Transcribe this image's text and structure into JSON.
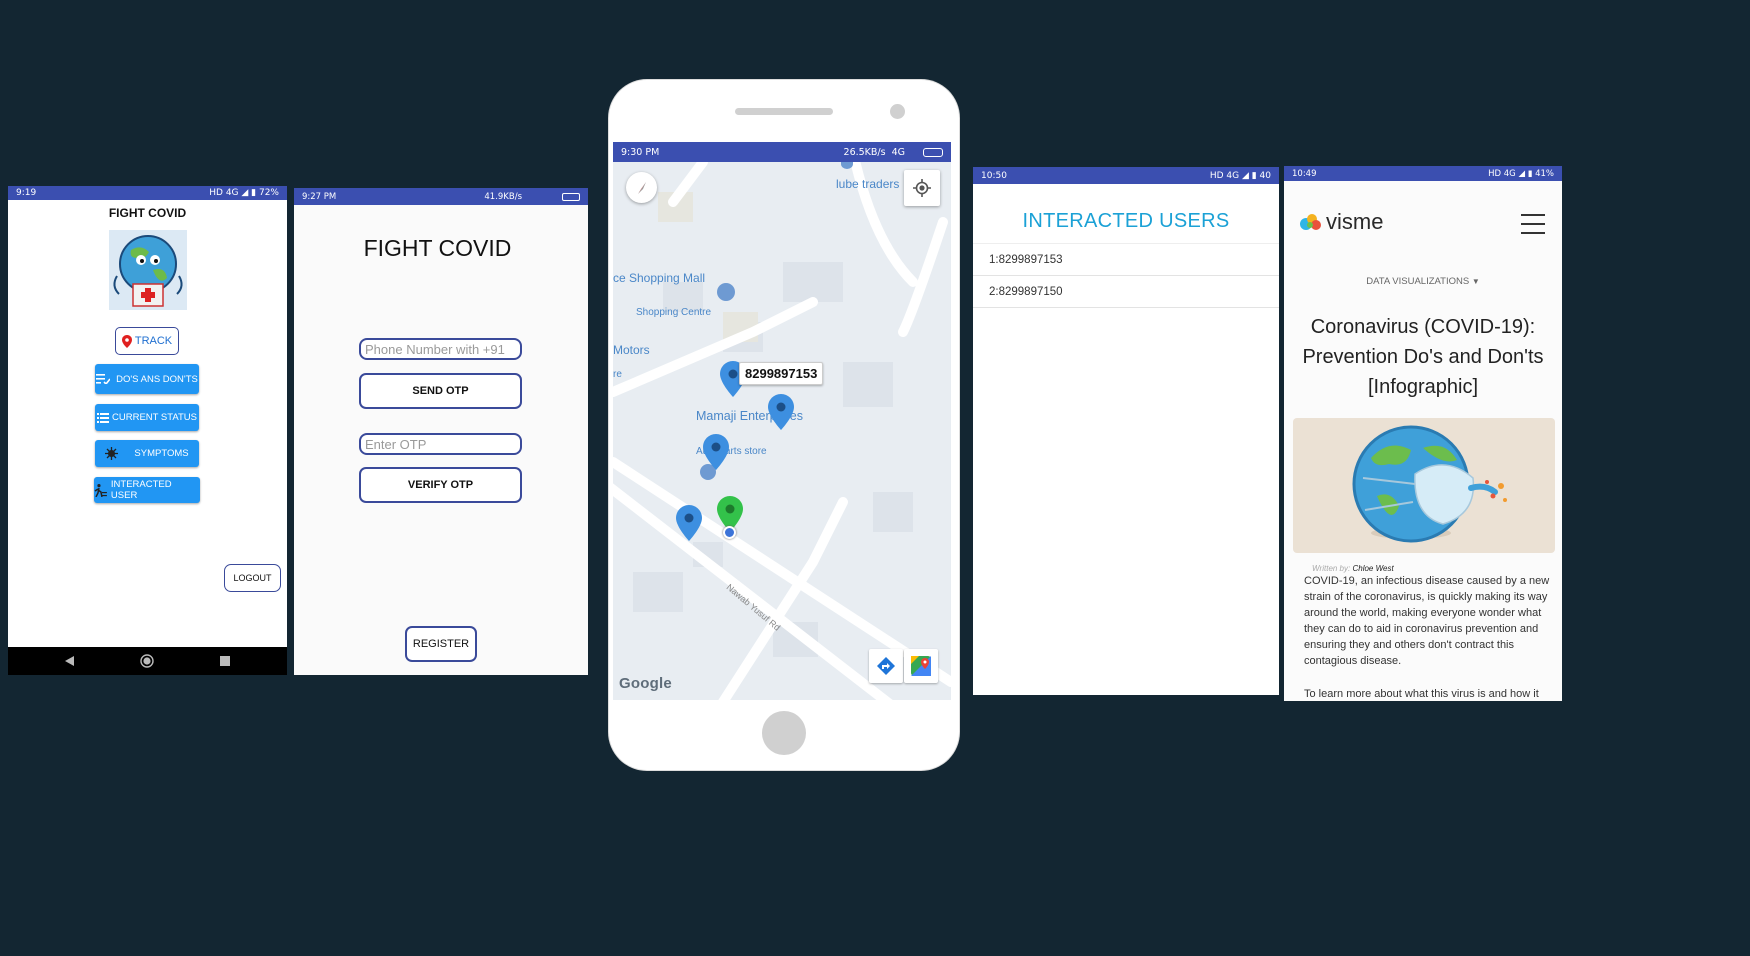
{
  "screen1": {
    "status_time": "9:19",
    "status_right": "HD 4G ◢ ▮ 72%",
    "title": "FIGHT COVID",
    "buttons": {
      "track": "TRACK",
      "dos": "DO'S ANS DON'TS",
      "status": "CURRENT STATUS",
      "symptoms": "SYMPTOMS",
      "interacted": "INTERACTED USER",
      "logout": "LOGOUT"
    }
  },
  "screen2": {
    "status_time": "9:27 PM",
    "status_speed": "41.9KB/s",
    "title": "FIGHT COVID",
    "phone_placeholder": "Phone Number with +91",
    "send_otp": "SEND OTP",
    "otp_placeholder": "Enter OTP",
    "verify_otp": "VERIFY OTP",
    "register": "REGISTER"
  },
  "screen3": {
    "status_time": "9:30 PM",
    "status_speed": "26.5KB/s",
    "status_net": "4G",
    "map_labels": {
      "lube": "lube traders",
      "mall": "ce Shopping Mall",
      "shopping_centre": "Shopping Centre",
      "motors": "Motors",
      "re": "re",
      "mamaji": "Mamaji Enterprises",
      "autoparts": "Auto parts store",
      "road": "Nawab Yusuf Rd",
      "google": "Google"
    },
    "callout": "8299897153"
  },
  "screen4": {
    "status_time": "10:50",
    "status_right": "HD 4G ◢ ▮ 40",
    "title": "INTERACTED USERS",
    "users": [
      "1:8299897153",
      "2:8299897150"
    ]
  },
  "screen5": {
    "status_time": "10:49",
    "status_right": "HD 4G ◢ ▮ 41%",
    "brand": "visme",
    "category": "DATA VISUALIZATIONS",
    "article_title": "Coronavirus (COVID-19): Prevention Do's and Don'ts [Infographic]",
    "byline_prefix": "Written by:",
    "author": "Chloe West",
    "body": "COVID-19, an infectious disease caused by a new strain of the coronavirus, is quickly making its way around the world, making everyone wonder what they can do to aid in coronavirus prevention and ensuring they and others don't contract this contagious disease.",
    "body2": "To learn more about what this virus is and how it"
  },
  "colors": {
    "background": "#132632",
    "status_bar": "#3b4fb0",
    "button_blue": "#2196f3",
    "outline": "#3a4a9a",
    "heading_cyan": "#1ba1d6",
    "pin_blue": "#3d8fe0",
    "pin_green": "#33c24a"
  }
}
